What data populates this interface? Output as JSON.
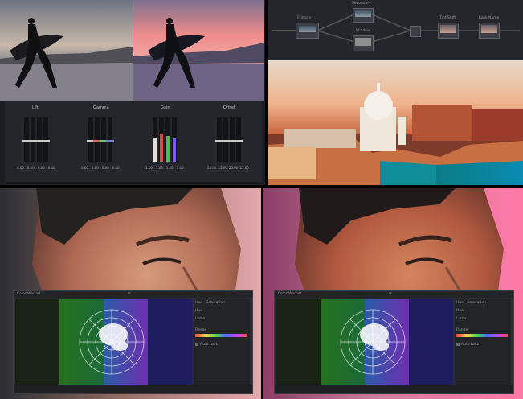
{
  "wheels": [
    {
      "label": "Lift",
      "values": [
        "0.00",
        "0.00",
        "0.00",
        "0.00"
      ]
    },
    {
      "label": "Gamma",
      "values": [
        "0.00",
        "0.00",
        "0.00",
        "0.00"
      ]
    },
    {
      "label": "Gain",
      "values": [
        "1.00",
        "1.00",
        "1.00",
        "1.00"
      ]
    },
    {
      "label": "Offset",
      "values": [
        "25.00",
        "25.00",
        "25.00",
        "25.00"
      ]
    }
  ],
  "nodes": {
    "n1": "Primary",
    "n2": "Secondary",
    "n3": "Window",
    "n4": "Tint Shift",
    "n5": "Look Name"
  },
  "color_warper": {
    "title": "Color Warper",
    "panel_title": "Hue - Saturation",
    "row1": "Hue",
    "row2": "Luma",
    "range_label": "Range",
    "auto_label": "Auto Lock"
  }
}
